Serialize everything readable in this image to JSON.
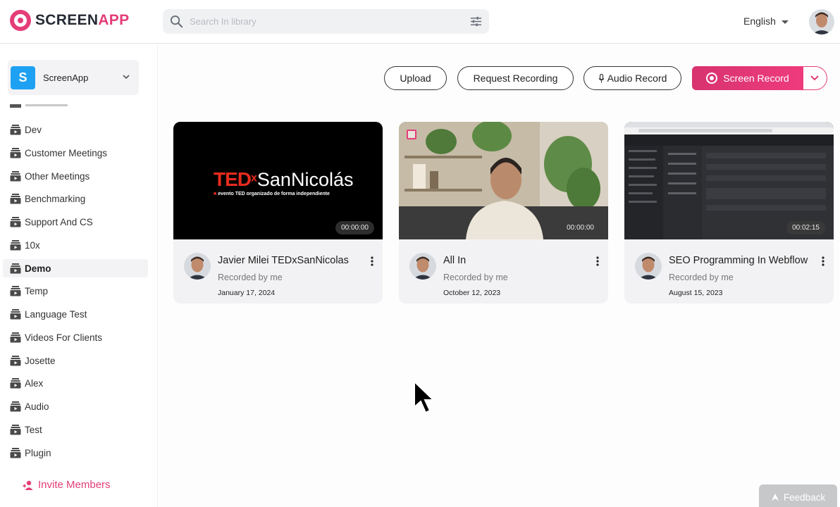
{
  "app": {
    "logo_part1": "SCREEN",
    "logo_part2": "APP",
    "accent_color": "#e43d78"
  },
  "search": {
    "placeholder": "Search In library"
  },
  "header": {
    "language": "English"
  },
  "sidebar": {
    "workspace": {
      "initial": "S",
      "name": "ScreenApp"
    },
    "folders": [
      {
        "label": "Dev",
        "active": false
      },
      {
        "label": "Customer Meetings",
        "active": false
      },
      {
        "label": "Other Meetings",
        "active": false
      },
      {
        "label": "Benchmarking",
        "active": false
      },
      {
        "label": "Support And CS",
        "active": false
      },
      {
        "label": "10x",
        "active": false
      },
      {
        "label": "Demo",
        "active": true
      },
      {
        "label": "Temp",
        "active": false
      },
      {
        "label": "Language Test",
        "active": false
      },
      {
        "label": "Videos For Clients",
        "active": false
      },
      {
        "label": "Josette",
        "active": false
      },
      {
        "label": "Alex",
        "active": false
      },
      {
        "label": "Audio",
        "active": false
      },
      {
        "label": "Test",
        "active": false
      },
      {
        "label": "Plugin",
        "active": false
      }
    ],
    "invite_label": "Invite Members"
  },
  "toolbar": {
    "upload_label": "Upload",
    "request_label": "Request Recording",
    "audio_label": "Audio Record",
    "screen_label": "Screen Record"
  },
  "videos": [
    {
      "title": "Javier Milei TEDxSanNicolas",
      "recorded_by": "Recorded by me",
      "date": "January 17, 2024",
      "duration": "00:00:00",
      "thumb_brand": "TED",
      "thumb_x": "x",
      "thumb_place": "SanNicolás",
      "thumb_tagline": "evento TED organizado de forma independiente"
    },
    {
      "title": "All In",
      "recorded_by": "Recorded by me",
      "date": "October 12, 2023",
      "duration": "00:00:00"
    },
    {
      "title": "SEO Programming In Webflow",
      "recorded_by": "Recorded by me",
      "date": "August 15, 2023",
      "duration": "00:02:15"
    }
  ],
  "feedback_label": "Feedback"
}
